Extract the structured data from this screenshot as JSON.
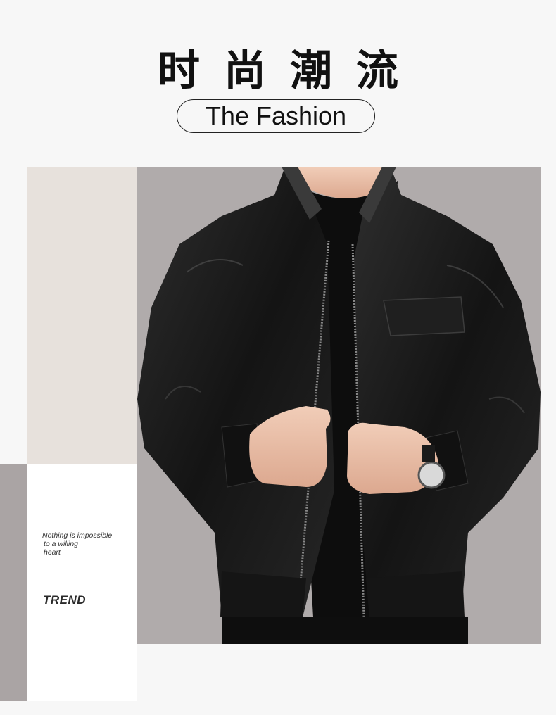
{
  "header": {
    "title_cn": "时尚潮流",
    "subtitle_en": "The Fashion"
  },
  "side_panel": {
    "quote_lines": [
      "Nothing is impossible",
      "to a willing",
      "heart"
    ],
    "trend_label": "TREND"
  },
  "photo": {
    "subject": "man wearing black leather jacket with wristwatch"
  },
  "colors": {
    "background": "#f7f7f7",
    "beige_block": "#e7e1dc",
    "grey_strip": "#aaa4a4",
    "photo_bg": "#b0abab",
    "jacket": "#1a1a1a"
  }
}
